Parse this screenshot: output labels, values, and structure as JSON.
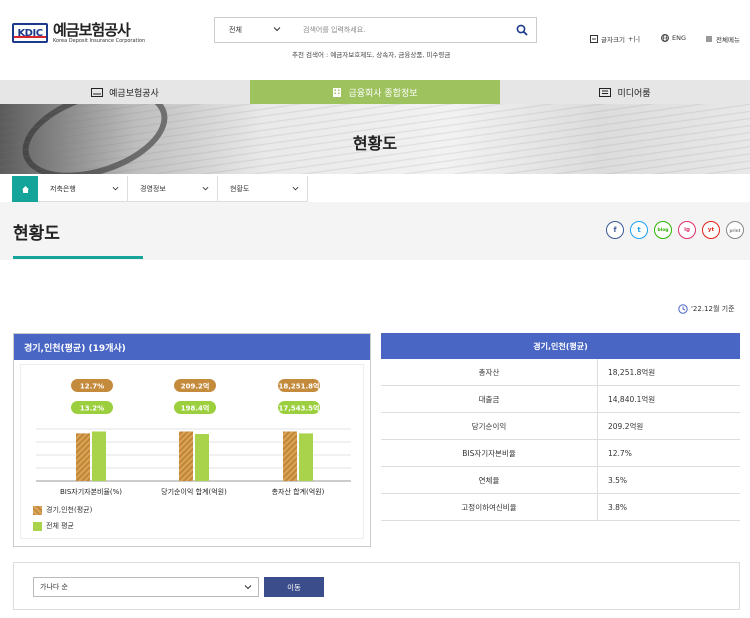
{
  "header": {
    "logo_abbr": "KDIC",
    "logo_korean": "예금보험공사",
    "logo_english": "Korea Deposit Insurance Corporation",
    "search_category": "전체",
    "search_placeholder": "검색어를 입력하세요.",
    "recommended_label": "추천 검색어 :",
    "recommended_terms": "예금자보호제도, 상속자, 금융상품, 미수령금",
    "util_font": "글자크기",
    "util_font_symbols": "+|-|",
    "util_lang": "ENG",
    "util_menu": "전체메뉴"
  },
  "nav": [
    {
      "label": "예금보험공사",
      "icon": "kdic-icon"
    },
    {
      "label": "금융회사 종합정보",
      "icon": "building-icon"
    },
    {
      "label": "미디어룸",
      "icon": "media-icon"
    }
  ],
  "banner_title": "현황도",
  "breadcrumb": [
    {
      "label": "저축은행"
    },
    {
      "label": "경영정보"
    },
    {
      "label": "현황도"
    }
  ],
  "page_title": "현황도",
  "sns": [
    "f",
    "t",
    "blog",
    "ig",
    "yt",
    "print"
  ],
  "date_label": "'22.12월 기준",
  "chart_panel_title": "경기,인천(평균) (19개사)",
  "chart_data": {
    "type": "bar",
    "categories": [
      "BIS자기자본비율(%)",
      "당기순이익 합계(억원)",
      "총자산 합계(억원)"
    ],
    "series": [
      {
        "name": "경기,인천(평균)",
        "labels": [
          "12.7%",
          "209.2억",
          "18,251.8억"
        ],
        "values": [
          12.7,
          209.2,
          18251.8
        ],
        "color": "#c89040"
      },
      {
        "name": "전체 평균",
        "labels": [
          "13.2%",
          "198.4억",
          "17,543.5억"
        ],
        "values": [
          13.2,
          198.4,
          17543.5
        ],
        "color": "#a8d34a"
      }
    ]
  },
  "table": {
    "header": "경기,인천(평균)",
    "rows": [
      {
        "label": "총자산",
        "value": "18,251.8억원"
      },
      {
        "label": "대출금",
        "value": "14,840.1억원"
      },
      {
        "label": "당기순이익",
        "value": "209.2억원"
      },
      {
        "label": "BIS자기자본비율",
        "value": "12.7%"
      },
      {
        "label": "연체율",
        "value": "3.5%"
      },
      {
        "label": "고정이하여신비율",
        "value": "3.8%"
      }
    ]
  },
  "sort": {
    "selected": "가나다 순",
    "button": "이동"
  }
}
